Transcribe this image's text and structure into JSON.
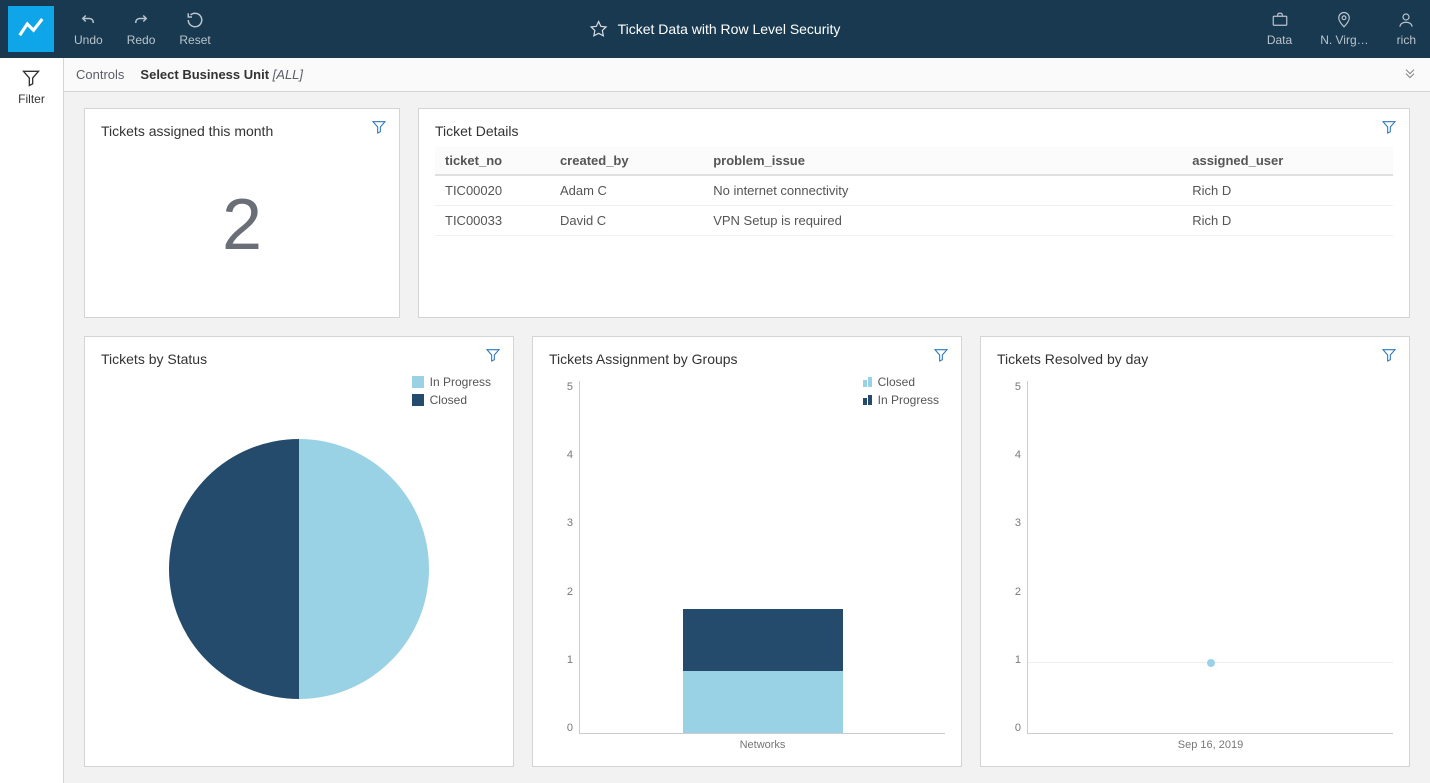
{
  "topbar": {
    "undo_label": "Undo",
    "redo_label": "Redo",
    "reset_label": "Reset",
    "title": "Ticket Data with Row Level Security",
    "data_label": "Data",
    "region_label": "N. Virg…",
    "user_label": "rich"
  },
  "leftrail": {
    "filter_label": "Filter"
  },
  "controls": {
    "label": "Controls",
    "select_label": "Select Business Unit",
    "select_value": "[ALL]"
  },
  "panel_assigned": {
    "title": "Tickets assigned this month",
    "value": "2"
  },
  "panel_details": {
    "title": "Ticket Details",
    "columns": {
      "c0": "ticket_no",
      "c1": "created_by",
      "c2": "problem_issue",
      "c3": "assigned_user"
    },
    "rows": [
      {
        "ticket_no": "TIC00020",
        "created_by": "Adam C",
        "problem_issue": "No internet connectivity",
        "assigned_user": "Rich D"
      },
      {
        "ticket_no": "TIC00033",
        "created_by": "David C",
        "problem_issue": "VPN Setup is required",
        "assigned_user": "Rich D"
      }
    ]
  },
  "panel_status": {
    "title": "Tickets by Status",
    "legend_in_progress": "In Progress",
    "legend_closed": "Closed"
  },
  "panel_groups": {
    "title": "Tickets Assignment by Groups",
    "legend_closed": "Closed",
    "legend_in_progress": "In Progress",
    "xcat": "Networks",
    "yticks": {
      "t0": "0",
      "t1": "1",
      "t2": "2",
      "t3": "3",
      "t4": "4",
      "t5": "5"
    }
  },
  "panel_resolved": {
    "title": "Tickets Resolved by day",
    "xcat": "Sep 16, 2019",
    "yticks": {
      "t0": "0",
      "t1": "1",
      "t2": "2",
      "t3": "3",
      "t4": "4",
      "t5": "5"
    }
  },
  "chart_data": [
    {
      "id": "tickets_by_status",
      "type": "pie",
      "title": "Tickets by Status",
      "series": [
        {
          "name": "In Progress",
          "value": 1,
          "color": "#99d2e5"
        },
        {
          "name": "Closed",
          "value": 1,
          "color": "#244b6b"
        }
      ]
    },
    {
      "id": "tickets_assignment_by_groups",
      "type": "bar",
      "stacked": true,
      "title": "Tickets Assignment by Groups",
      "categories": [
        "Networks"
      ],
      "series": [
        {
          "name": "Closed",
          "values": [
            1
          ],
          "color": "#99d2e5"
        },
        {
          "name": "In Progress",
          "values": [
            1
          ],
          "color": "#244b6b"
        }
      ],
      "ylabel": "",
      "ylim": [
        0,
        5
      ],
      "yticks": [
        0,
        1,
        2,
        3,
        4,
        5
      ]
    },
    {
      "id": "tickets_resolved_by_day",
      "type": "scatter",
      "title": "Tickets Resolved by day",
      "x": [
        "Sep 16, 2019"
      ],
      "values": [
        1
      ],
      "ylabel": "",
      "ylim": [
        0,
        5
      ],
      "yticks": [
        0,
        1,
        2,
        3,
        4,
        5
      ]
    }
  ]
}
